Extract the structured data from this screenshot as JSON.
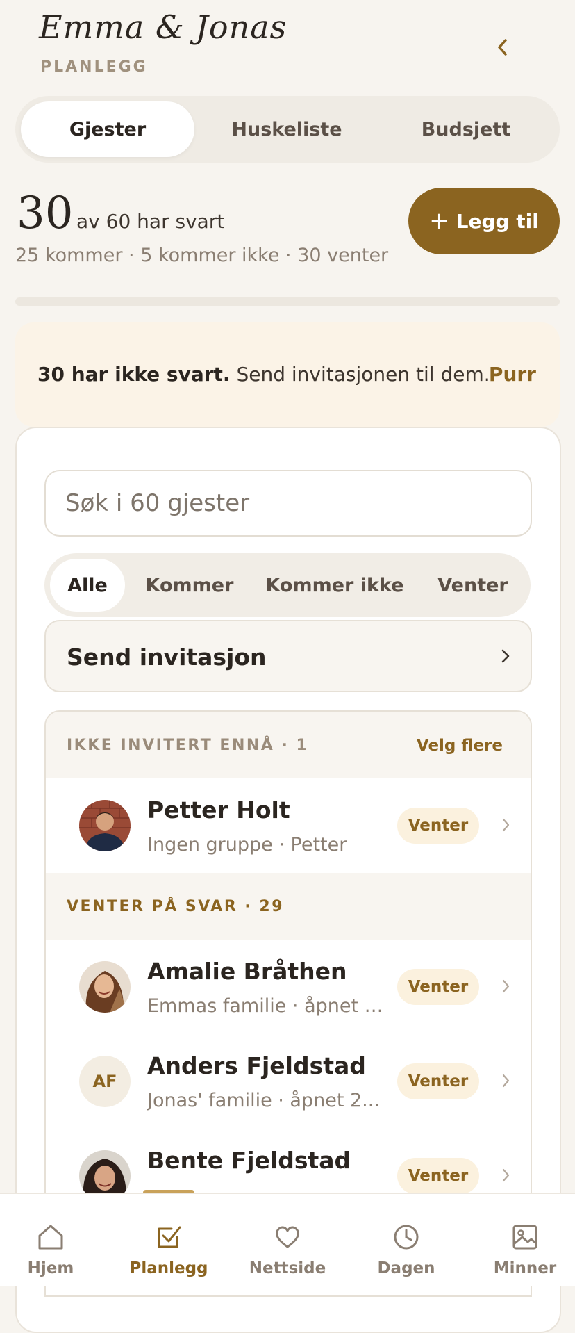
{
  "header": {
    "title": "Emma & Jonas",
    "subtitle": "PLANLEGG",
    "back_icon": "chevron-left-icon"
  },
  "tabs": [
    {
      "label": "Gjester",
      "active": true
    },
    {
      "label": "Huskeliste",
      "active": false
    },
    {
      "label": "Budsjett",
      "active": false
    }
  ],
  "stats": {
    "responded": "30",
    "responded_text": "av 60 har svart",
    "summary": "25 kommer · 5 kommer ikke · 30 venter",
    "add_button": "Legg til"
  },
  "banner": {
    "bold": "30 har ikke svart.",
    "text": " Send invitasjonen til dem.",
    "action": "Purr"
  },
  "search": {
    "placeholder": "Søk i 60 gjester"
  },
  "filters": [
    {
      "label": "Alle",
      "active": true
    },
    {
      "label": "Kommer",
      "active": false
    },
    {
      "label": "Kommer ikke",
      "active": false
    },
    {
      "label": "Venter",
      "active": false
    }
  ],
  "send_invitation": {
    "label": "Send invitasjon"
  },
  "sections": [
    {
      "title": "IKKE INVITERT ENNÅ · 1",
      "action": "Velg flere",
      "color": "#9a8b7a",
      "guests": [
        {
          "name": "Petter Holt",
          "sub": "Ingen gruppe · Petter",
          "status": "Venter",
          "initials": "",
          "avatar": "photo-man"
        }
      ]
    },
    {
      "title": "VENTER PÅ SVAR · 29",
      "action": "",
      "color": "#8b6420",
      "guests": [
        {
          "name": "Amalie Bråthen",
          "sub": "Emmas familie · åpnet 1...",
          "status": "Venter",
          "initials": "",
          "avatar": "photo-woman"
        },
        {
          "name": "Anders Fjeldstad",
          "sub": "Jonas' familie · åpnet 2...",
          "status": "Venter",
          "initials": "AF",
          "avatar": "initials"
        },
        {
          "name": "Bente Fjeldstad",
          "sub": "",
          "status": "Venter",
          "initials": "",
          "avatar": "photo-woman-dark"
        }
      ]
    }
  ],
  "bottom_nav": [
    {
      "label": "Hjem",
      "icon": "home-icon",
      "active": false
    },
    {
      "label": "Planlegg",
      "icon": "checklist-icon",
      "active": true
    },
    {
      "label": "Nettside",
      "icon": "heart-icon",
      "active": false
    },
    {
      "label": "Dagen",
      "icon": "clock-icon",
      "active": false
    },
    {
      "label": "Minner",
      "icon": "image-icon",
      "active": false
    }
  ],
  "colors": {
    "accent": "#8b6420",
    "background": "#f7f4ef",
    "banner": "#fbf3e7",
    "status_bg": "#fbf1de"
  }
}
